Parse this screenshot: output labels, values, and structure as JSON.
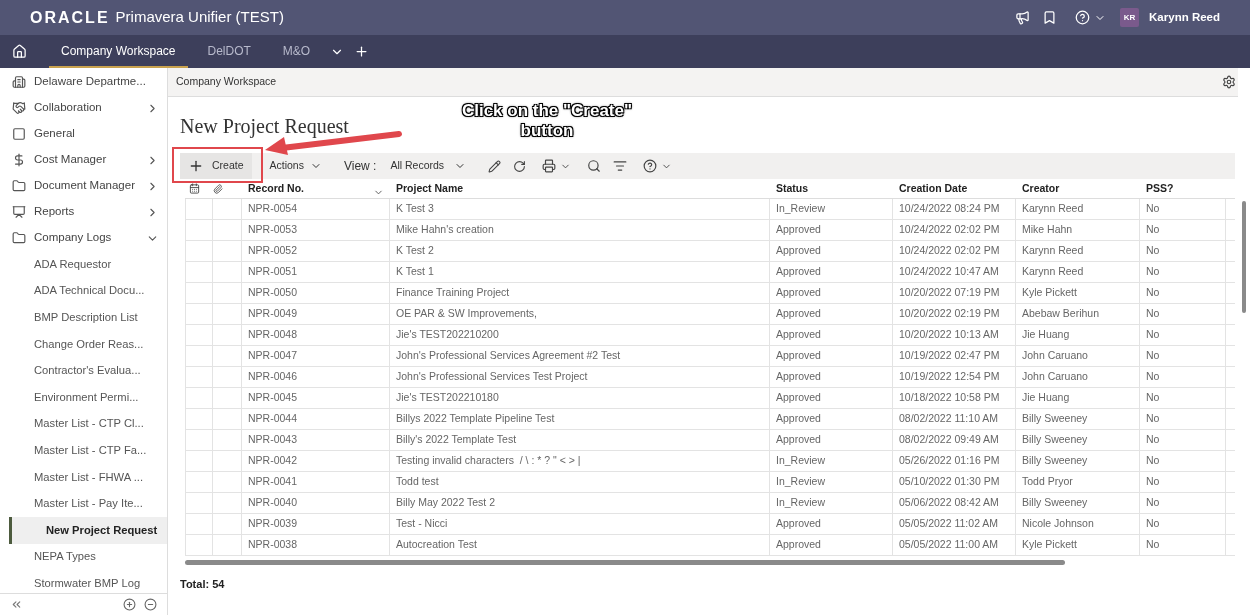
{
  "header": {
    "brand": "ORACLE",
    "product": "Primavera Unifier (TEST)",
    "avatar": "KR",
    "user": "Karynn Reed"
  },
  "tabs": [
    {
      "label": "Company Workspace",
      "selected": true
    },
    {
      "label": "DelDOT",
      "selected": false
    },
    {
      "label": "M&O",
      "selected": false
    }
  ],
  "sidebar": {
    "items": [
      {
        "label": "Delaware Departme...",
        "kind": "link",
        "selected": false
      },
      {
        "label": "Collaboration",
        "kind": "group",
        "expanded": false,
        "selected": false
      },
      {
        "label": "General",
        "kind": "link",
        "selected": false
      },
      {
        "label": "Cost Manager",
        "kind": "group",
        "expanded": false,
        "selected": false
      },
      {
        "label": "Document Manager",
        "kind": "group",
        "expanded": false,
        "selected": false
      },
      {
        "label": "Reports",
        "kind": "group",
        "expanded": false,
        "selected": false
      },
      {
        "label": "Company Logs",
        "kind": "group",
        "expanded": true,
        "selected": false,
        "children": [
          {
            "label": "ADA Requestor",
            "selected": false
          },
          {
            "label": "ADA Technical Docu...",
            "selected": false
          },
          {
            "label": "BMP Description List",
            "selected": false
          },
          {
            "label": "Change Order Reas...",
            "selected": false
          },
          {
            "label": "Contractor's Evalua...",
            "selected": false
          },
          {
            "label": "Environment Permi...",
            "selected": false
          },
          {
            "label": "Master List - CTP Cl...",
            "selected": false
          },
          {
            "label": "Master List - CTP Fa...",
            "selected": false
          },
          {
            "label": "Master List - FHWA ...",
            "selected": false
          },
          {
            "label": "Master List - Pay Ite...",
            "selected": false
          },
          {
            "label": "New Project Request",
            "selected": true
          },
          {
            "label": "NEPA Types",
            "selected": false
          },
          {
            "label": "Stormwater BMP Log",
            "selected": false
          }
        ]
      }
    ]
  },
  "breadcrumb": "Company Workspace",
  "page_title": "New Project Request",
  "toolbar": {
    "create": "Create",
    "actions": "Actions",
    "view_label": "View :",
    "view_value": "All Records"
  },
  "table": {
    "columns": [
      "Record No.",
      "Project Name",
      "Status",
      "Creation Date",
      "Creator",
      "PSS?"
    ],
    "rows": [
      [
        "NPR-0054",
        "K Test 3",
        "In_Review",
        "10/24/2022 08:24 PM",
        "Karynn Reed",
        "No"
      ],
      [
        "NPR-0053",
        "Mike Hahn's creation",
        "Approved",
        "10/24/2022 02:02 PM",
        "Mike Hahn",
        "No"
      ],
      [
        "NPR-0052",
        "K Test 2",
        "Approved",
        "10/24/2022 02:02 PM",
        "Karynn Reed",
        "No"
      ],
      [
        "NPR-0051",
        "K Test 1",
        "Approved",
        "10/24/2022 10:47 AM",
        "Karynn Reed",
        "No"
      ],
      [
        "NPR-0050",
        "Finance Training Project",
        "Approved",
        "10/20/2022 07:19 PM",
        "Kyle Pickett",
        "No"
      ],
      [
        "NPR-0049",
        "OE PAR & SW Improvements,",
        "Approved",
        "10/20/2022 02:19 PM",
        "Abebaw Berihun",
        "No"
      ],
      [
        "NPR-0048",
        "Jie's TEST202210200",
        "Approved",
        "10/20/2022 10:13 AM",
        "Jie Huang",
        "No"
      ],
      [
        "NPR-0047",
        "John's Professional Services Agreement #2 Test",
        "Approved",
        "10/19/2022 02:47 PM",
        "John Caruano",
        "No"
      ],
      [
        "NPR-0046",
        "John's Professional Services Test Project",
        "Approved",
        "10/19/2022 12:54 PM",
        "John Caruano",
        "No"
      ],
      [
        "NPR-0045",
        "Jie's TEST202210180",
        "Approved",
        "10/18/2022 10:58 PM",
        "Jie Huang",
        "No"
      ],
      [
        "NPR-0044",
        "Billys 2022 Template Pipeline Test",
        "Approved",
        "08/02/2022 11:10 AM",
        "Billy Sweeney",
        "No"
      ],
      [
        "NPR-0043",
        "Billy's 2022 Template Test",
        "Approved",
        "08/02/2022 09:49 AM",
        "Billy Sweeney",
        "No"
      ],
      [
        "NPR-0042",
        "Testing invalid characters  / \\ : * ? \" < > |",
        "In_Review",
        "05/26/2022 01:16 PM",
        "Billy Sweeney",
        "No"
      ],
      [
        "NPR-0041",
        "Todd test",
        "In_Review",
        "05/10/2022 01:30 PM",
        "Todd Pryor",
        "No"
      ],
      [
        "NPR-0040",
        "Billy May 2022 Test 2",
        "In_Review",
        "05/06/2022 08:42 AM",
        "Billy Sweeney",
        "No"
      ],
      [
        "NPR-0039",
        "Test - Nicci",
        "Approved",
        "05/05/2022 11:02 AM",
        "Nicole Johnson",
        "No"
      ],
      [
        "NPR-0038",
        "Autocreation Test",
        "Approved",
        "05/05/2022 11:00 AM",
        "Kyle Pickett",
        "No"
      ]
    ]
  },
  "total": "Total: 54",
  "annotation": {
    "text": "Click on the \"Create\" button"
  }
}
